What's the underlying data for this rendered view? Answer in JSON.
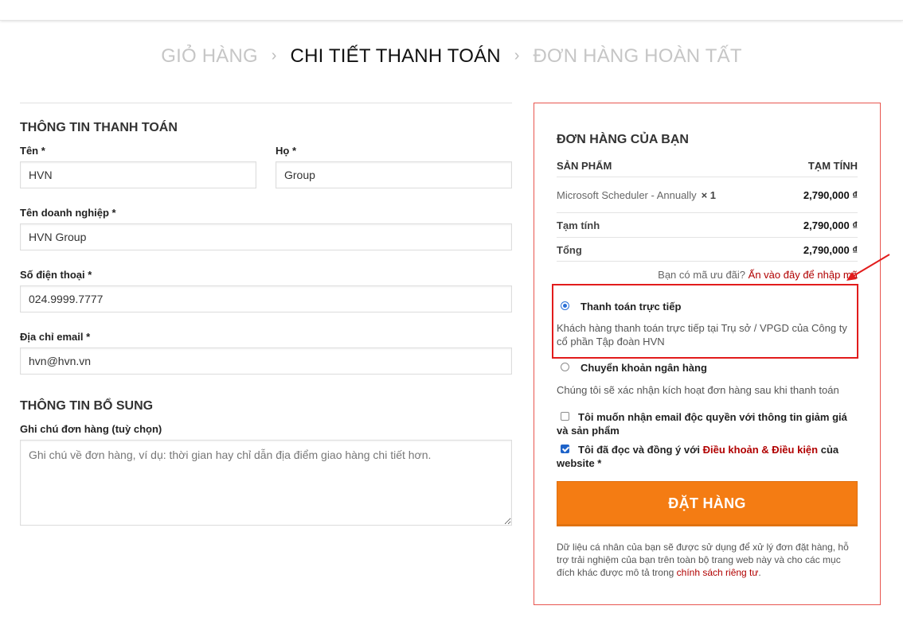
{
  "steps": {
    "cart": "GIỎ HÀNG",
    "checkout": "CHI TIẾT THANH TOÁN",
    "complete": "ĐƠN HÀNG HOÀN TẤT",
    "separator": "›"
  },
  "billing": {
    "title": "THÔNG TIN THANH TOÁN",
    "first_name": {
      "label": "Tên *",
      "value": "HVN"
    },
    "last_name": {
      "label": "Họ *",
      "value": "Group"
    },
    "company": {
      "label": "Tên doanh nghiệp *",
      "value": "HVN Group"
    },
    "phone": {
      "label": "Số điện thoại *",
      "value": "024.9999.7777"
    },
    "email": {
      "label": "Địa chỉ email *",
      "value": "hvn@hvn.vn"
    }
  },
  "additional": {
    "title": "THÔNG TIN BỔ SUNG",
    "notes_label": "Ghi chú đơn hàng (tuỳ chọn)",
    "notes_placeholder": "Ghi chú về đơn hàng, ví dụ: thời gian hay chỉ dẫn địa điểm giao hàng chi tiết hơn."
  },
  "order": {
    "title": "ĐƠN HÀNG CỦA BẠN",
    "col_product": "SẢN PHẨM",
    "col_subtotal": "TẠM TÍNH",
    "item_name": "Microsoft Scheduler - Annually",
    "item_qty": "× 1",
    "item_price": "2,790,000 ₫",
    "subtotal_label": "Tạm tính",
    "subtotal_value": "2,790,000 ₫",
    "total_label": "Tổng",
    "total_value": "2,790,000 ₫",
    "coupon_text": "Bạn có mã ưu đãi?",
    "coupon_link": "Ấn vào đây để nhập mã"
  },
  "payment": {
    "direct_title": "Thanh toán trực tiếp",
    "direct_desc": "Khách hàng thanh toán trực tiếp tại Trụ sở / VPGD của Công ty cổ phần Tập đoàn HVN",
    "bank_title": "Chuyển khoản ngân hàng",
    "bank_desc": "Chúng tôi sẽ xác nhận kích hoạt đơn hàng sau khi thanh toán",
    "selected": "direct"
  },
  "consents": {
    "newsletter": "Tôi muốn nhận email độc quyền với thông tin giảm giá và sản phẩm",
    "newsletter_checked": false,
    "terms_prefix": "Tôi đã đọc và đồng ý với",
    "terms_link": "Điều khoản & Điều kiện",
    "terms_suffix": "của website *",
    "terms_checked": true
  },
  "place_order": "ĐẶT HÀNG",
  "privacy": {
    "text": "Dữ liệu cá nhân của bạn sẽ được sử dụng để xử lý đơn đặt hàng, hỗ trợ trải nghiệm của bạn trên toàn bộ trang web này và cho các mục đích khác được mô tả trong",
    "link": "chính sách riêng tư",
    "end": "."
  },
  "colors": {
    "accent_button": "#f47c13",
    "link_red": "#b10000",
    "annotation_red": "#e21c1c",
    "box_border": "#e8564f"
  }
}
